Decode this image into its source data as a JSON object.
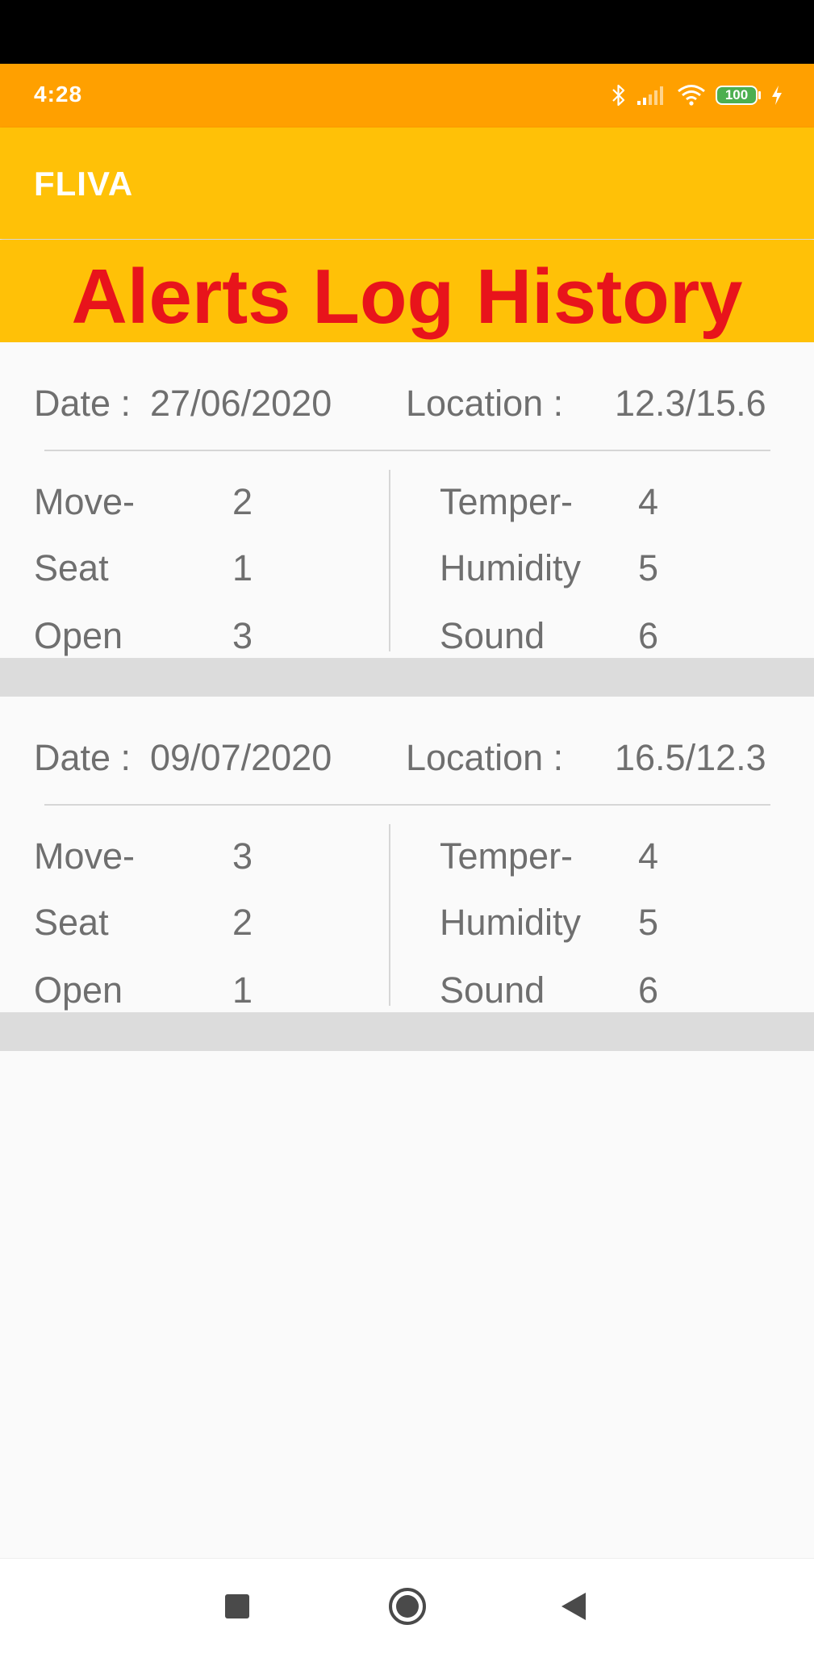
{
  "status_bar": {
    "time": "4:28",
    "battery_level": "100",
    "icons": [
      "bluetooth-icon",
      "signal-icon",
      "wifi-icon",
      "battery-icon",
      "charging-icon"
    ]
  },
  "app_bar": {
    "title": "FLIVA"
  },
  "banner": {
    "title": "Alerts Log History"
  },
  "alerts": [
    {
      "date_label": "Date :",
      "date": "27/06/2020",
      "location_label": "Location :",
      "location": "12.3/15.6",
      "left_items": [
        {
          "label": "Move-",
          "value": "2"
        },
        {
          "label": "Seat",
          "value": "1"
        },
        {
          "label": "Open",
          "value": "3"
        }
      ],
      "right_items": [
        {
          "label": "Temper-",
          "value": "4"
        },
        {
          "label": "Humidity",
          "value": "5"
        },
        {
          "label": "Sound",
          "value": "6"
        }
      ]
    },
    {
      "date_label": "Date :",
      "date": "09/07/2020",
      "location_label": "Location :",
      "location": "16.5/12.3",
      "left_items": [
        {
          "label": "Move-",
          "value": "3"
        },
        {
          "label": "Seat",
          "value": "2"
        },
        {
          "label": "Open",
          "value": "1"
        }
      ],
      "right_items": [
        {
          "label": "Temper-",
          "value": "4"
        },
        {
          "label": "Humidity",
          "value": "5"
        },
        {
          "label": "Sound",
          "value": "6"
        }
      ]
    }
  ],
  "nav_bar": {
    "icons": [
      "recent-apps-icon",
      "home-icon",
      "back-icon"
    ]
  },
  "colors": {
    "status_bar": "#ffa000",
    "app_bar": "#ffc107",
    "banner_text": "#e8141b",
    "body_text": "#6f6f6f",
    "separator": "#dcdcdc",
    "battery_fill": "#4caf50"
  }
}
